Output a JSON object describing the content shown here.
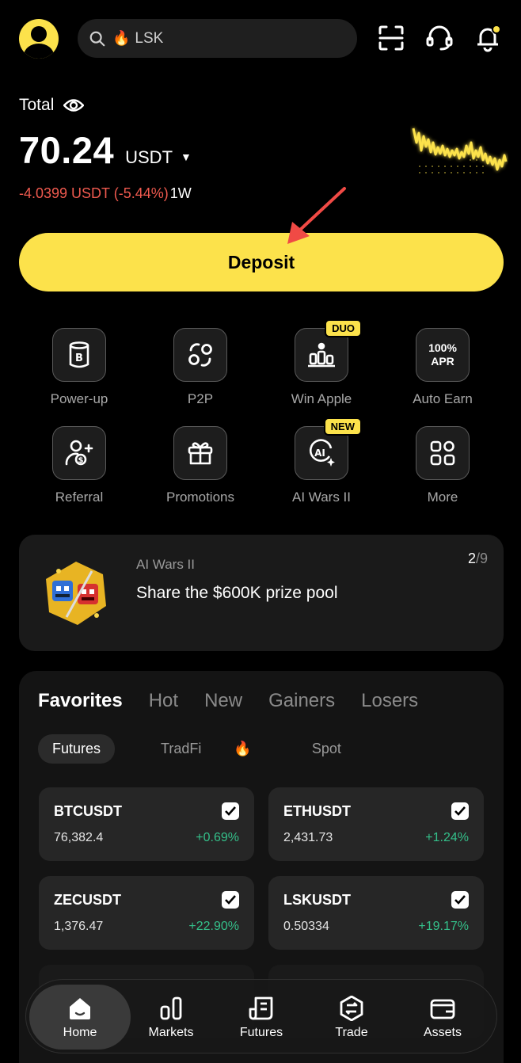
{
  "header": {
    "search_placeholder": "LSK",
    "avatar": "avatar",
    "icons": [
      "scan-icon",
      "support-icon",
      "bell-icon"
    ]
  },
  "total": {
    "label": "Total",
    "amount": "70.24",
    "currency": "USDT",
    "pnl": "-4.0399 USDT (-5.44%)",
    "period": "1W"
  },
  "deposit": {
    "label": "Deposit"
  },
  "quick_actions": [
    {
      "label": "Power-up",
      "icon": "power-up-icon",
      "tag": ""
    },
    {
      "label": "P2P",
      "icon": "p2p-icon",
      "tag": ""
    },
    {
      "label": "Win Apple",
      "icon": "podium-icon",
      "tag": "DUO"
    },
    {
      "label": "Auto Earn",
      "icon": "apr-icon",
      "tag": "",
      "icon_text": "100%\nAPR"
    },
    {
      "label": "Referral",
      "icon": "referral-icon",
      "tag": ""
    },
    {
      "label": "Promotions",
      "icon": "gift-icon",
      "tag": ""
    },
    {
      "label": "AI Wars II",
      "icon": "ai-icon",
      "tag": "NEW"
    },
    {
      "label": "More",
      "icon": "grid-icon",
      "tag": ""
    }
  ],
  "banner": {
    "subtitle": "AI Wars II",
    "title": "Share the $600K prize pool",
    "page_current": "2",
    "page_total": "/9"
  },
  "market": {
    "tabs": [
      "Favorites",
      "Hot",
      "New",
      "Gainers",
      "Losers"
    ],
    "active_tab": "Favorites",
    "subtabs": [
      "Futures",
      "TradFi",
      "Spot"
    ],
    "active_subtab": "Futures",
    "cards": [
      {
        "symbol": "BTCUSDT",
        "price": "76,382.4",
        "change": "+0.69%"
      },
      {
        "symbol": "ETHUSDT",
        "price": "2,431.73",
        "change": "+1.24%"
      },
      {
        "symbol": "ZECUSDT",
        "price": "1,376.47",
        "change": "+22.90%"
      },
      {
        "symbol": "LSKUSDT",
        "price": "0.50334",
        "change": "+19.17%"
      }
    ]
  },
  "bottom_nav": [
    {
      "label": "Home",
      "icon": "home-icon"
    },
    {
      "label": "Markets",
      "icon": "markets-icon"
    },
    {
      "label": "Futures",
      "icon": "futures-icon"
    },
    {
      "label": "Trade",
      "icon": "trade-icon"
    },
    {
      "label": "Assets",
      "icon": "wallet-icon"
    }
  ],
  "colors": {
    "accent": "#fce24b",
    "negative": "#f05a4f",
    "positive": "#34c08a",
    "background": "#000000"
  }
}
